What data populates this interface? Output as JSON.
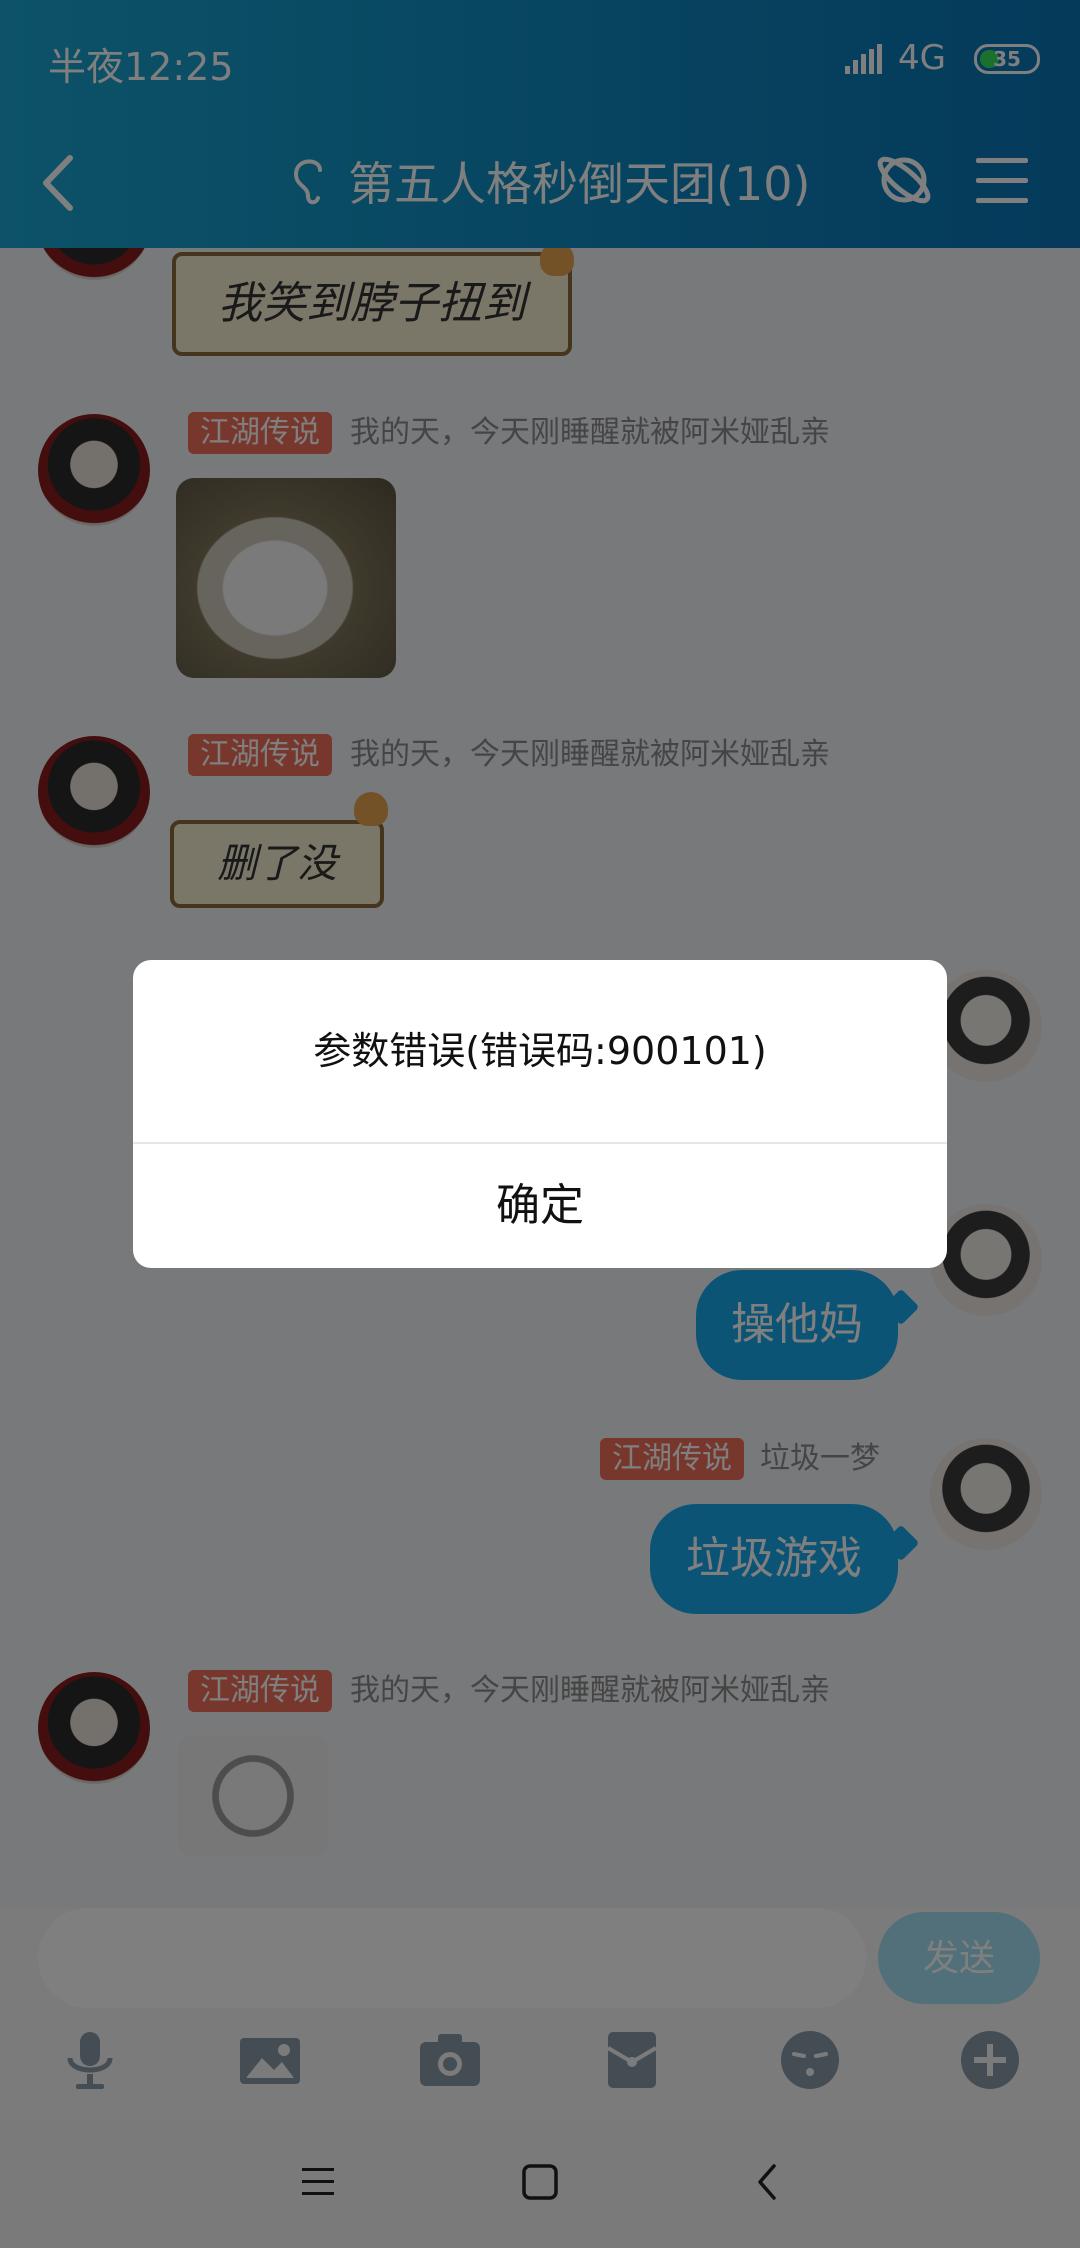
{
  "status_bar": {
    "time": "半夜12:25",
    "network": "4G",
    "battery_level": "35",
    "battery_fraction": 0.35
  },
  "header": {
    "title": "第五人格秒倒天团(10)"
  },
  "messages": [
    {
      "id": "m0",
      "side": "left",
      "type": "sticker",
      "sticker_text": "我笑到脖子扭到"
    },
    {
      "id": "m1",
      "side": "left",
      "tag": "江湖传说",
      "nickname": "我的天，今天刚睡醒就被阿米娅乱亲",
      "type": "image",
      "image": "white-cat-photo"
    },
    {
      "id": "m2",
      "side": "left",
      "tag": "江湖传说",
      "nickname": "我的天，今天刚睡醒就被阿米娅乱亲",
      "type": "sticker",
      "sticker_text": "删了没"
    },
    {
      "id": "m3",
      "side": "right",
      "type": "text",
      "text": "操他妈"
    },
    {
      "id": "m4",
      "side": "right",
      "tag": "江湖传说",
      "nickname": "垃圾一梦",
      "type": "text",
      "text": "垃圾游戏"
    },
    {
      "id": "m5",
      "side": "left",
      "tag": "江湖传说",
      "nickname": "我的天，今天刚睡醒就被阿米娅乱亲",
      "type": "image",
      "image": "meme-bear-face"
    }
  ],
  "input": {
    "placeholder": "",
    "send_label": "发送"
  },
  "toolbar": {
    "icons": [
      "microphone-icon",
      "image-icon",
      "camera-icon",
      "red-packet-icon",
      "emoji-icon",
      "plus-icon"
    ]
  },
  "dialog": {
    "message": "参数错误(错误码:900101)",
    "confirm_label": "确定"
  },
  "colors": {
    "header": "#0d87c0",
    "bubble": "#17a9ec",
    "tag": "#f06e5a",
    "send": "#a3e0f5"
  }
}
